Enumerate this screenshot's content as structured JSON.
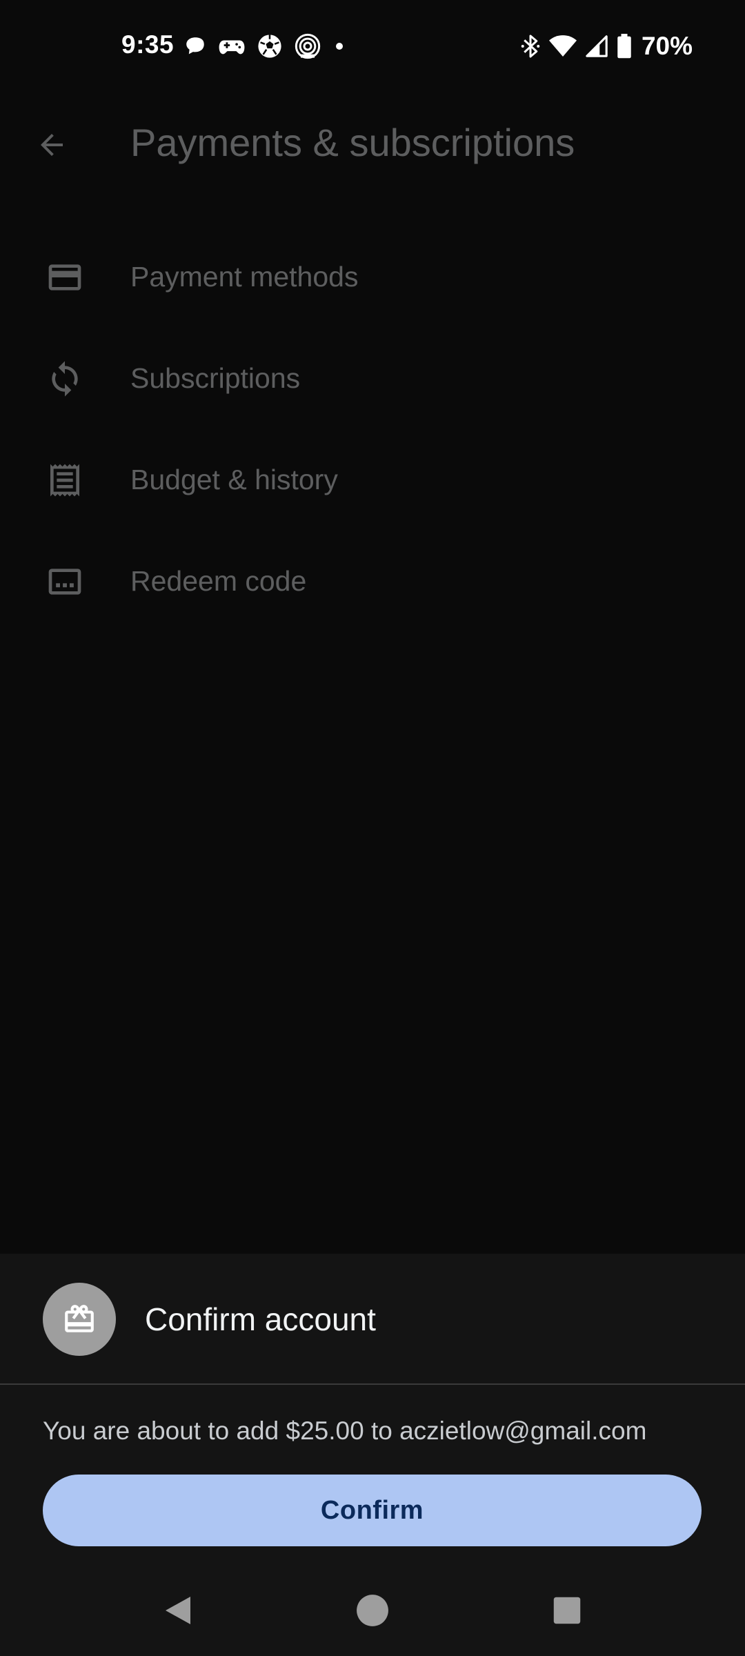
{
  "status_bar": {
    "time": "9:35",
    "battery_percent": "70%",
    "notification_icons": [
      "chat-bubble-icon",
      "game-controller-icon",
      "soccer-ball-icon",
      "target-app-icon",
      "more-notifications-dot-icon"
    ],
    "system_icons": [
      "bluetooth-icon",
      "wifi-icon",
      "cellular-signal-icon",
      "battery-icon"
    ]
  },
  "toolbar": {
    "back_icon": "arrow-back-icon",
    "title": "Payments & subscriptions"
  },
  "menu": {
    "items": [
      {
        "label": "Payment methods",
        "icon": "credit-card-icon"
      },
      {
        "label": "Subscriptions",
        "icon": "sync-icon"
      },
      {
        "label": "Budget & history",
        "icon": "receipt-icon"
      },
      {
        "label": "Redeem code",
        "icon": "redeem-code-icon"
      }
    ]
  },
  "sheet": {
    "icon": "gift-card-icon",
    "title": "Confirm account",
    "message": "You are about to add $25.00 to aczietlow@gmail.com",
    "confirm_label": "Confirm"
  },
  "nav_bar": {
    "buttons": [
      "back-triangle-icon",
      "home-circle-icon",
      "recents-square-icon"
    ]
  },
  "colors": {
    "background": "#0a0a0a",
    "sheet_background": "#141414",
    "confirm_button": "#aec6f3",
    "confirm_text": "#0b2a5b"
  }
}
